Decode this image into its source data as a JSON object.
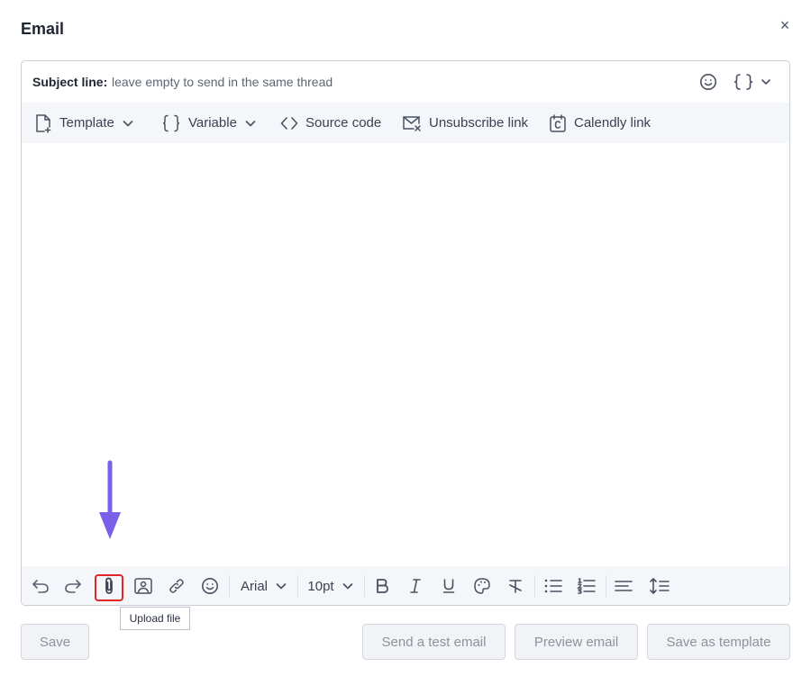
{
  "dialog": {
    "title": "Email",
    "close_symbol": "×"
  },
  "subject": {
    "label": "Subject line:",
    "placeholder": "leave empty to send in the same thread",
    "value": ""
  },
  "toolbar_top": {
    "template": "Template",
    "variable": "Variable",
    "source_code": "Source code",
    "unsubscribe": "Unsubscribe link",
    "calendly": "Calendly link"
  },
  "toolbar_bottom": {
    "font": "Arial",
    "size": "10pt",
    "highlighted_tool": "upload-file"
  },
  "tooltip": {
    "text": "Upload file"
  },
  "buttons": {
    "save": "Save",
    "send_test": "Send a test email",
    "preview": "Preview email",
    "save_template": "Save as template"
  },
  "colors": {
    "highlight_border": "#e0262b",
    "arrow": "#7b5fe8",
    "toolbar_bg": "#f4f6fa"
  }
}
